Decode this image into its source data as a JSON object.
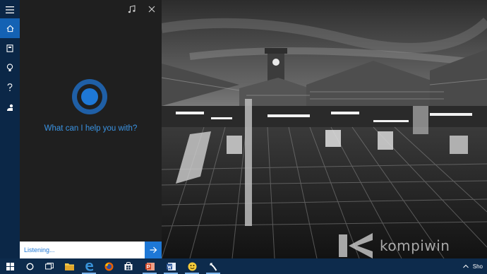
{
  "cortana": {
    "prompt": "What can I help you with?",
    "input_value": "Listening..."
  },
  "rail": {
    "items": [
      {
        "name": "hamburger-menu-icon"
      },
      {
        "name": "home-icon"
      },
      {
        "name": "notebook-icon"
      },
      {
        "name": "lightbulb-icon"
      },
      {
        "name": "help-icon"
      },
      {
        "name": "feedback-icon"
      }
    ]
  },
  "header_icons": [
    "music-note-icon",
    "close-icon"
  ],
  "taskbar": {
    "items": [
      "start-icon",
      "cortana-icon",
      "task-view-icon",
      "file-explorer-icon",
      "edge-icon",
      "firefox-icon",
      "store-icon",
      "powerpoint-icon",
      "word-icon",
      "emoji-app-icon",
      "tool-app-icon"
    ],
    "tray_language": "Sho"
  },
  "watermark": {
    "text": "kompiwin"
  },
  "colors": {
    "accent": "#1e78d6",
    "panel": "#1f1f1f",
    "rail": "#0b2747",
    "taskbar": "#0d2b4c",
    "prompt_text": "#3a93e3"
  }
}
